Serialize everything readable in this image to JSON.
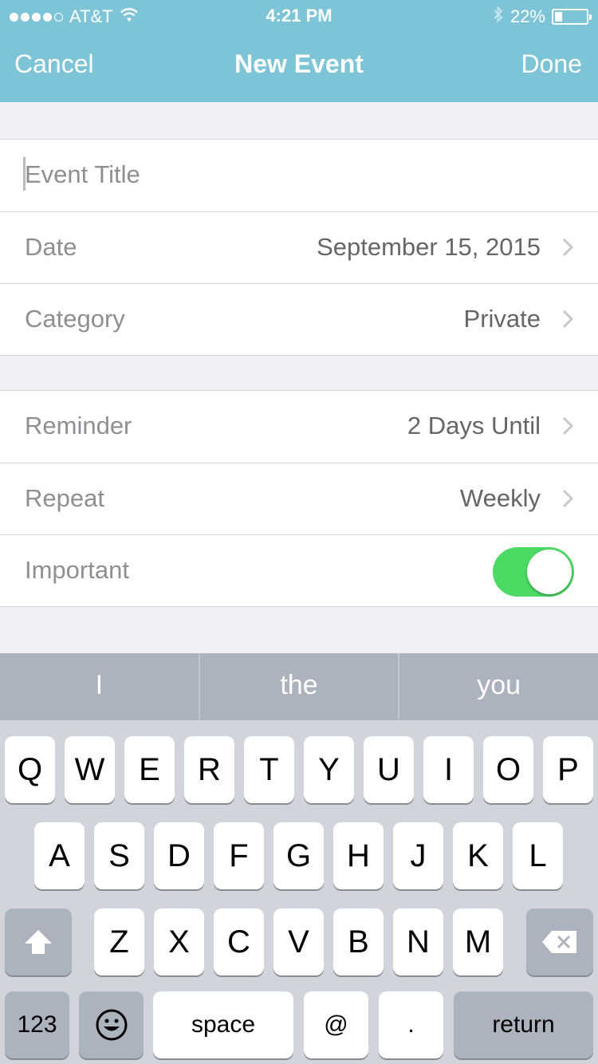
{
  "status_bar": {
    "carrier": "AT&T",
    "time": "4:21 PM",
    "battery": "22%",
    "battery_level": 0.22,
    "signal_bars": 4,
    "icons": [
      "wifi-icon",
      "bluetooth-icon",
      "battery-icon"
    ]
  },
  "nav": {
    "cancel": "Cancel",
    "title": "New Event",
    "done": "Done"
  },
  "form": {
    "title_placeholder": "Event Title",
    "date_label": "Date",
    "date_value": "September 15, 2015",
    "category_label": "Category",
    "category_value": "Private",
    "reminder_label": "Reminder",
    "reminder_value": "2 Days Until",
    "repeat_label": "Repeat",
    "repeat_value": "Weekly",
    "important_label": "Important",
    "important_on": true
  },
  "suggestions": [
    "I",
    "the",
    "you"
  ],
  "keyboard": {
    "row1": [
      "Q",
      "W",
      "E",
      "R",
      "T",
      "Y",
      "U",
      "I",
      "O",
      "P"
    ],
    "row2": [
      "A",
      "S",
      "D",
      "F",
      "G",
      "H",
      "J",
      "K",
      "L"
    ],
    "row3": [
      "Z",
      "X",
      "C",
      "V",
      "B",
      "N",
      "M"
    ],
    "numbers": "123",
    "space": "space",
    "at": "@",
    "period": ".",
    "return": "return"
  },
  "colors": {
    "nav_bar": "#7ec4d7",
    "toggle_on": "#4cd964",
    "keyboard_bg": "#d1d5db"
  }
}
